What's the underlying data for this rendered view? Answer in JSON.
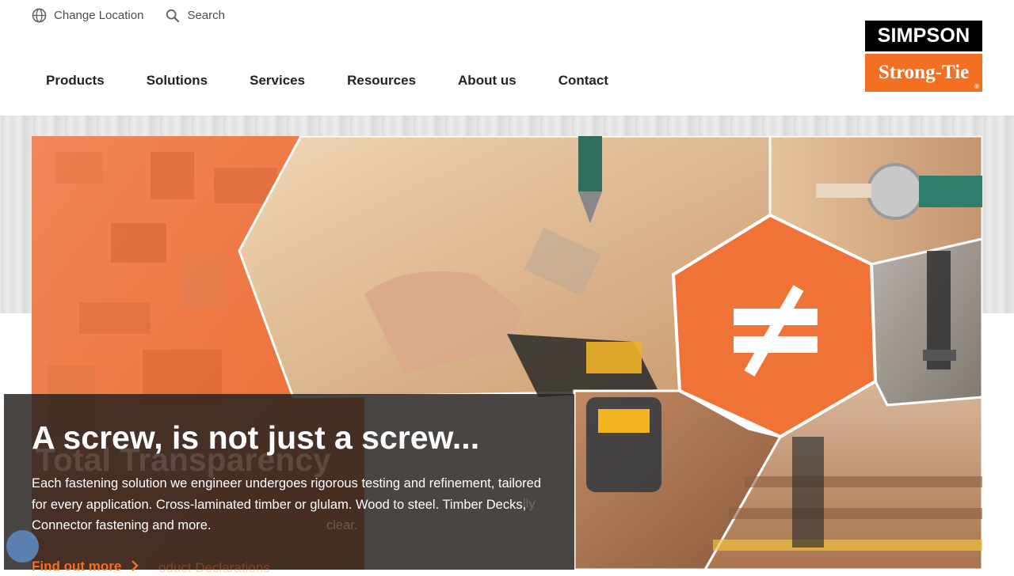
{
  "utility": {
    "location_label": "Change Location",
    "search_label": "Search"
  },
  "nav": {
    "items": [
      {
        "label": "Products"
      },
      {
        "label": "Solutions"
      },
      {
        "label": "Services"
      },
      {
        "label": "Resources"
      },
      {
        "label": "About us"
      },
      {
        "label": "Contact"
      }
    ]
  },
  "logo": {
    "line1": "SIMPSON",
    "line2": "Strong-Tie",
    "registered": "®"
  },
  "hero": {
    "headline": "A screw, is not just a screw...",
    "body": "Each fastening solution we engineer undergoes rigorous testing and refinement, tailored for every application. Cross-laminated timber or glulam. Wood to steel. Timber Decks, Connector fastening and more.",
    "cta_label": "Find out more",
    "ghost_title": "Total Transparency",
    "ghost_body": "clear.",
    "ghost_body2": "lly",
    "ghost_cta": "oduct Declarations",
    "center_symbol": "≠"
  },
  "colors": {
    "brand_orange": "#f36f21",
    "brand_black": "#000000",
    "caption_bg": "#26211f",
    "chat_button": "#5b7fae"
  },
  "icons": {
    "location": "globe-icon",
    "search": "search-icon",
    "cta": "chevron-right-icon",
    "chat": "chat-bubble-icon"
  }
}
